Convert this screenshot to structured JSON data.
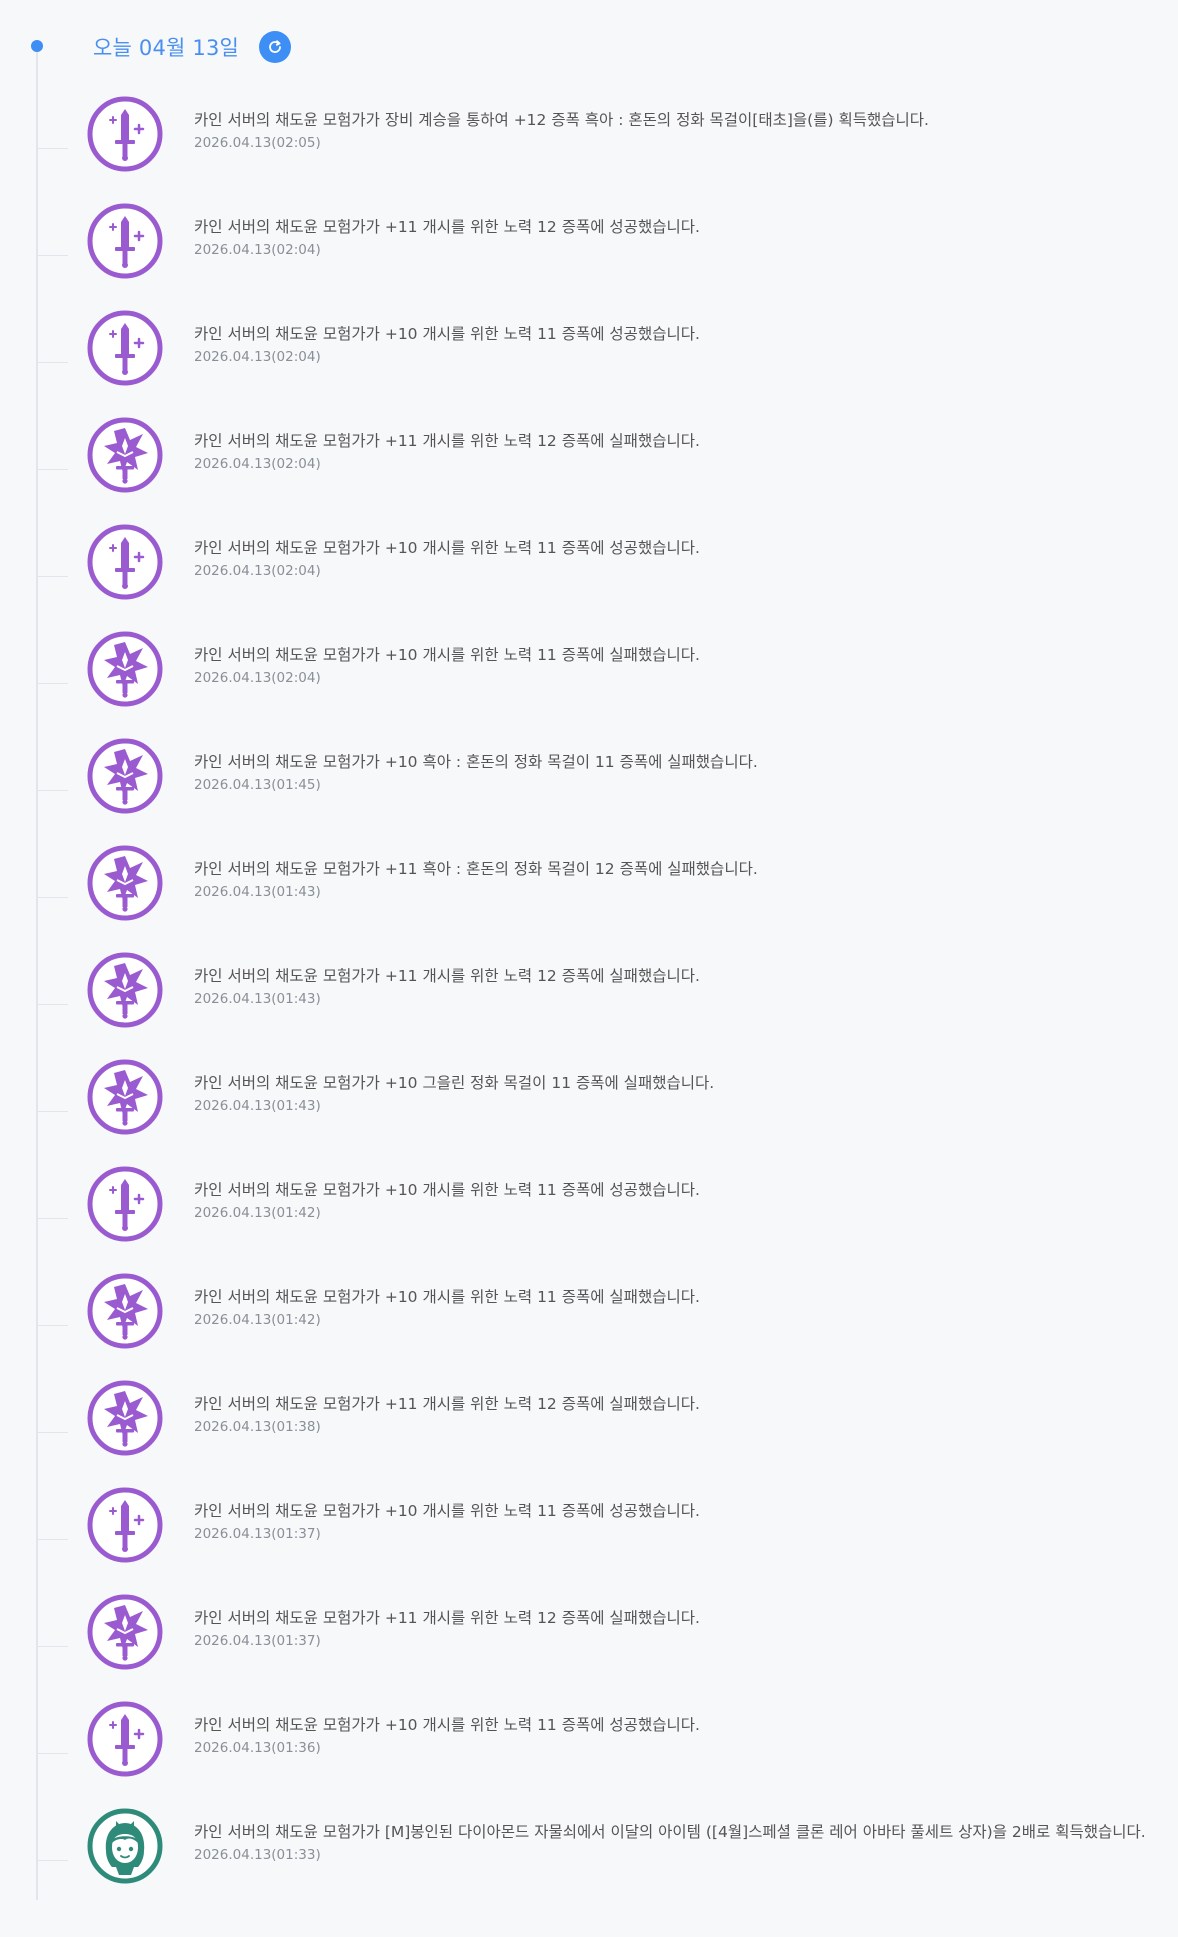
{
  "header": {
    "date_label": "오늘 04월 13일",
    "accent_color": "#3d8ef5"
  },
  "icons": {
    "sword-success": {
      "color": "#9b5bd0",
      "name": "sword-sparkle-icon"
    },
    "sword-fail": {
      "color": "#9b5bd0",
      "name": "broken-star-sword-icon"
    },
    "character": {
      "color": "#2e8b7a",
      "name": "character-avatar-icon"
    }
  },
  "entries": [
    {
      "icon": "sword-success",
      "message": "카인 서버의 채도윤 모험가가 장비 계승을 통하여 +12 증폭 흑아 : 혼돈의 정화 목걸이[태초]을(를) 획득했습니다.",
      "time": "2026.04.13(02:05)"
    },
    {
      "icon": "sword-success",
      "message": "카인 서버의 채도윤 모험가가 +11 개시를 위한 노력 12 증폭에 성공했습니다.",
      "time": "2026.04.13(02:04)"
    },
    {
      "icon": "sword-success",
      "message": "카인 서버의 채도윤 모험가가 +10 개시를 위한 노력 11 증폭에 성공했습니다.",
      "time": "2026.04.13(02:04)"
    },
    {
      "icon": "sword-fail",
      "message": "카인 서버의 채도윤 모험가가 +11 개시를 위한 노력 12 증폭에 실패했습니다.",
      "time": "2026.04.13(02:04)"
    },
    {
      "icon": "sword-success",
      "message": "카인 서버의 채도윤 모험가가 +10 개시를 위한 노력 11 증폭에 성공했습니다.",
      "time": "2026.04.13(02:04)"
    },
    {
      "icon": "sword-fail",
      "message": "카인 서버의 채도윤 모험가가 +10 개시를 위한 노력 11 증폭에 실패했습니다.",
      "time": "2026.04.13(02:04)"
    },
    {
      "icon": "sword-fail",
      "message": "카인 서버의 채도윤 모험가가 +10 흑아 : 혼돈의 정화 목걸이 11 증폭에 실패했습니다.",
      "time": "2026.04.13(01:45)"
    },
    {
      "icon": "sword-fail",
      "message": "카인 서버의 채도윤 모험가가 +11 흑아 : 혼돈의 정화 목걸이 12 증폭에 실패했습니다.",
      "time": "2026.04.13(01:43)"
    },
    {
      "icon": "sword-fail",
      "message": "카인 서버의 채도윤 모험가가 +11 개시를 위한 노력 12 증폭에 실패했습니다.",
      "time": "2026.04.13(01:43)"
    },
    {
      "icon": "sword-fail",
      "message": "카인 서버의 채도윤 모험가가 +10 그을린 정화 목걸이 11 증폭에 실패했습니다.",
      "time": "2026.04.13(01:43)"
    },
    {
      "icon": "sword-success",
      "message": "카인 서버의 채도윤 모험가가 +10 개시를 위한 노력 11 증폭에 성공했습니다.",
      "time": "2026.04.13(01:42)"
    },
    {
      "icon": "sword-fail",
      "message": "카인 서버의 채도윤 모험가가 +10 개시를 위한 노력 11 증폭에 실패했습니다.",
      "time": "2026.04.13(01:42)"
    },
    {
      "icon": "sword-fail",
      "message": "카인 서버의 채도윤 모험가가 +11 개시를 위한 노력 12 증폭에 실패했습니다.",
      "time": "2026.04.13(01:38)"
    },
    {
      "icon": "sword-success",
      "message": "카인 서버의 채도윤 모험가가 +10 개시를 위한 노력 11 증폭에 성공했습니다.",
      "time": "2026.04.13(01:37)"
    },
    {
      "icon": "sword-fail",
      "message": "카인 서버의 채도윤 모험가가 +11 개시를 위한 노력 12 증폭에 실패했습니다.",
      "time": "2026.04.13(01:37)"
    },
    {
      "icon": "sword-success",
      "message": "카인 서버의 채도윤 모험가가 +10 개시를 위한 노력 11 증폭에 성공했습니다.",
      "time": "2026.04.13(01:36)"
    },
    {
      "icon": "character",
      "message": "카인 서버의 채도윤 모험가가 [M]봉인된 다이아몬드 자물쇠에서 이달의 아이템 ([4월]스페셜 클론 레어 아바타 풀세트 상자)을 2배로 획득했습니다.",
      "time": "2026.04.13(01:33)"
    }
  ]
}
